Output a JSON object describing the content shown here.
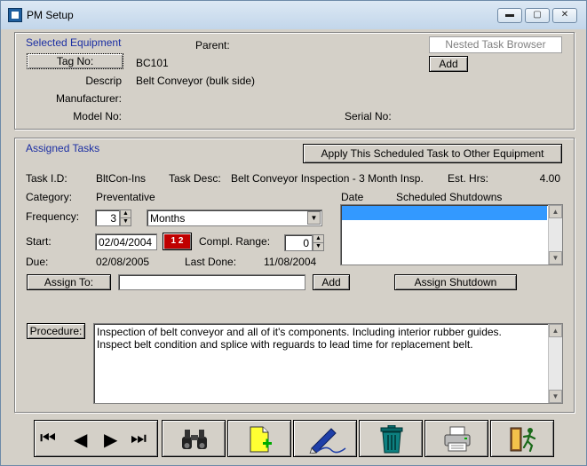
{
  "window": {
    "title": "PM Setup",
    "min_glyph": "▬",
    "max_glyph": "▢",
    "close_glyph": "✕"
  },
  "equipment": {
    "section_title": "Selected Equipment",
    "parent_label": "Parent:",
    "nested_browser_label": "Nested Task Browser",
    "add_label": "Add",
    "tag_button": "Tag No:",
    "tag_value": "BC101",
    "descrip_label": "Descrip",
    "descrip_value": "Belt Conveyor (bulk side)",
    "manufacturer_label": "Manufacturer:",
    "model_label": "Model No:",
    "serial_label": "Serial No:"
  },
  "tasks": {
    "section_title": "Assigned Tasks",
    "apply_button": "Apply This Scheduled Task to Other Equipment",
    "task_id_label": "Task I.D:",
    "task_id_value": "BltCon-Ins",
    "task_desc_label": "Task Desc:",
    "task_desc_value": "Belt Conveyor Inspection - 3 Month Insp.",
    "est_hrs_label": "Est. Hrs:",
    "est_hrs_value": "4.00",
    "category_label": "Category:",
    "category_value": "Preventative",
    "frequency_label": "Frequency:",
    "frequency_value": "3",
    "frequency_unit": "Months",
    "start_label": "Start:",
    "start_value": "02/04/2004",
    "calendar_glyph": "1 2",
    "compl_range_label": "Compl. Range:",
    "compl_range_value": "0",
    "due_label": "Due:",
    "due_value": "02/08/2005",
    "last_done_label": "Last Done:",
    "last_done_value": "11/08/2004",
    "date_col": "Date",
    "shutdowns_col": "Scheduled Shutdowns",
    "assign_to_button": "Assign To:",
    "assign_to_value": "",
    "assign_add_button": "Add",
    "assign_shutdown_button": "Assign Shutdown",
    "procedure_button": "Procedure:",
    "procedure_text": "Inspection of belt conveyor and all of it's components. Including interior rubber guides.\nInspect belt condition and splice with reguards to lead time for replacement belt."
  },
  "toolbar": {
    "first_glyph": "⏮",
    "prev_glyph": "◀",
    "next_glyph": "▶",
    "last_glyph": "⏭",
    "icons": [
      "binoculars-icon",
      "new-document-icon",
      "edit-pen-icon",
      "trash-can-icon",
      "printer-icon",
      "exit-door-icon"
    ]
  },
  "colors": {
    "highlight": "#3399ff",
    "label_blue": "#1c2fa3",
    "face": "#d4d0c8"
  }
}
